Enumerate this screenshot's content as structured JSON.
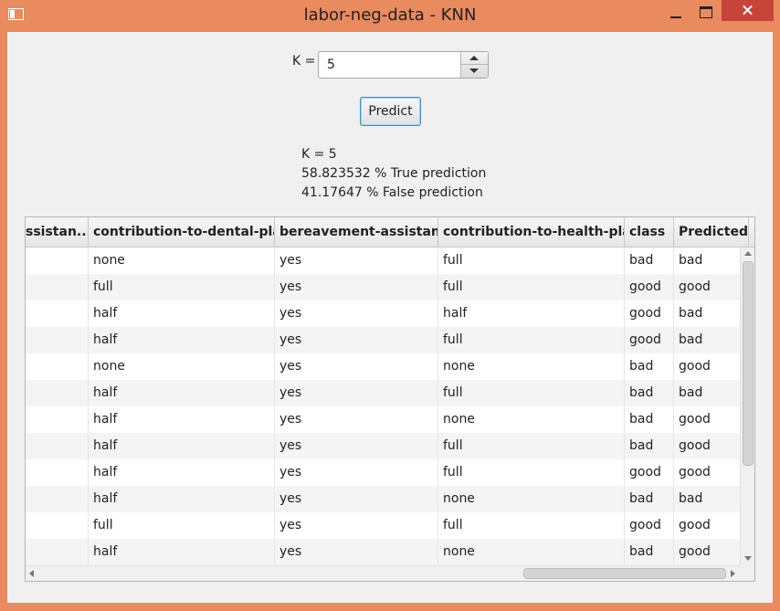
{
  "window": {
    "title": "labor-neg-data - KNN"
  },
  "controls": {
    "k_label": "K =",
    "k_value": "5",
    "predict_label": "Predict"
  },
  "results": {
    "k_line": "K = 5",
    "true_line": "58.823532 % True prediction",
    "false_line": "41.17647 % False prediction"
  },
  "table": {
    "columns": [
      "ssistan...",
      "contribution-to-dental-plan",
      "bereavement-assistance",
      "contribution-to-health-plan",
      "class",
      "Predicted"
    ],
    "rows": [
      [
        "",
        "none",
        "yes",
        "full",
        "bad",
        "bad"
      ],
      [
        "",
        "full",
        "yes",
        "full",
        "good",
        "good"
      ],
      [
        "",
        "half",
        "yes",
        "half",
        "good",
        "bad"
      ],
      [
        "",
        "half",
        "yes",
        "full",
        "good",
        "bad"
      ],
      [
        "",
        "none",
        "yes",
        "none",
        "bad",
        "good"
      ],
      [
        "",
        "half",
        "yes",
        "full",
        "bad",
        "bad"
      ],
      [
        "",
        "half",
        "yes",
        "none",
        "bad",
        "good"
      ],
      [
        "",
        "half",
        "yes",
        "full",
        "bad",
        "good"
      ],
      [
        "",
        "half",
        "yes",
        "full",
        "good",
        "good"
      ],
      [
        "",
        "half",
        "yes",
        "none",
        "bad",
        "bad"
      ],
      [
        "",
        "full",
        "yes",
        "full",
        "good",
        "good"
      ],
      [
        "",
        "half",
        "yes",
        "none",
        "bad",
        "good"
      ]
    ]
  }
}
